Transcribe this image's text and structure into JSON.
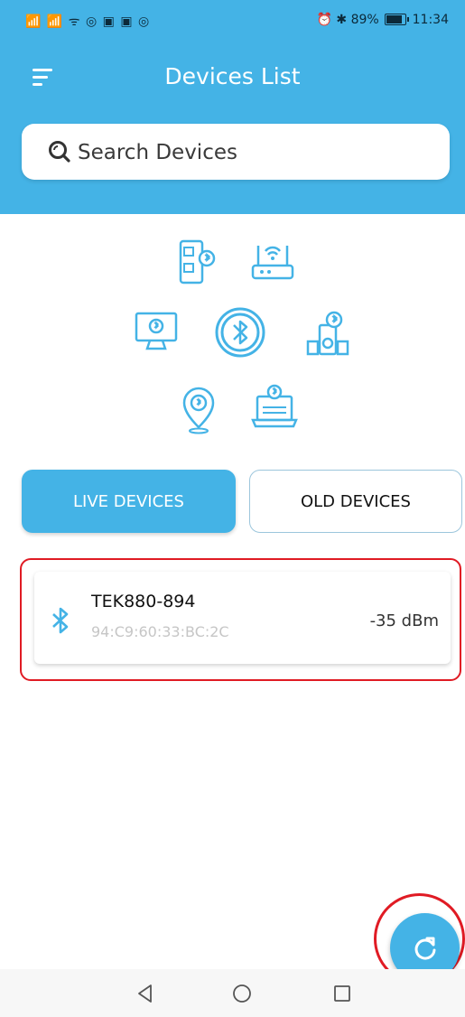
{
  "status_bar": {
    "left_icons": "📶 📶 ᯤ ◎ ▣ ▣ ◎",
    "right_icons": "⏰ ✱",
    "battery": "89%",
    "time": "11:34"
  },
  "header": {
    "title": "Devices List",
    "menu_icon": "menu-icon"
  },
  "search": {
    "placeholder": "Search Devices",
    "value": ""
  },
  "tabs": [
    {
      "label": "LIVE DEVICES",
      "active": true
    },
    {
      "label": "OLD DEVICES",
      "active": false
    }
  ],
  "devices": [
    {
      "name": "TEK880-894",
      "mac": "94:C9:60:33:BC:2C",
      "rssi": "-35 dBm",
      "icon": "bluetooth-icon"
    }
  ],
  "fab": {
    "icon": "refresh-icon"
  },
  "nav": {
    "back": "back-icon",
    "home": "home-icon",
    "recents": "recents-icon"
  },
  "colors": {
    "accent": "#44b3e6",
    "highlight": "#e01b24"
  }
}
